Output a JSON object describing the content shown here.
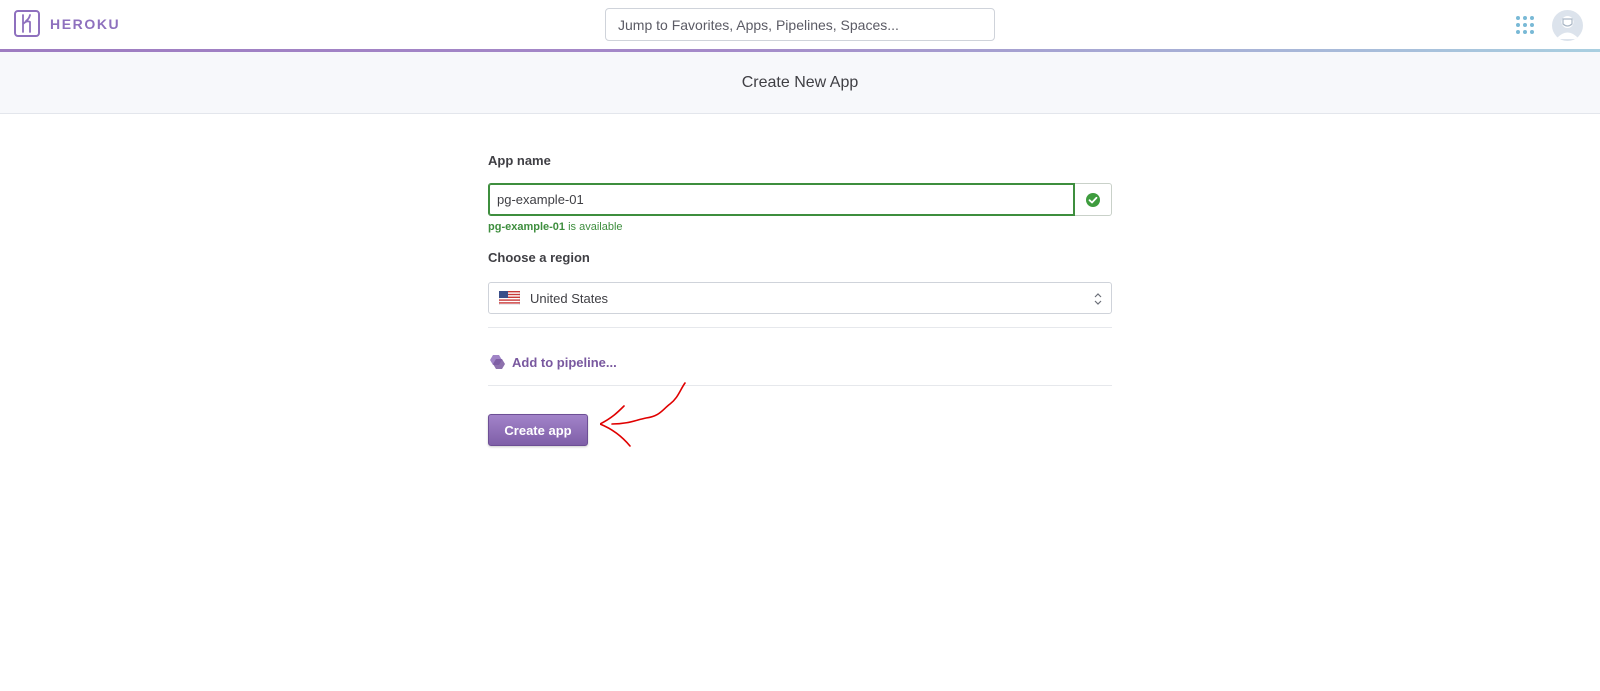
{
  "brand": {
    "name": "HEROKU",
    "color": "#8e70be"
  },
  "search": {
    "placeholder": "Jump to Favorites, Apps, Pipelines, Spaces...",
    "icon": "search-icon"
  },
  "nav": {
    "apps_icon": "grid-icon",
    "avatar_icon": "user-avatar-icon"
  },
  "page": {
    "title": "Create New App"
  },
  "form": {
    "app_name_label": "App name",
    "app_name_value": "pg-example-01",
    "availability": {
      "name": "pg-example-01",
      "suffix": " is available",
      "color": "#3e8e3e"
    },
    "region_label": "Choose a region",
    "region_value": "United States",
    "region_flag": "us-flag-icon",
    "pipeline_link": "Add to pipeline...",
    "submit_label": "Create app"
  },
  "colors": {
    "accent": "#79589f",
    "success": "#3e8e3e",
    "annotation": "#e00000"
  }
}
